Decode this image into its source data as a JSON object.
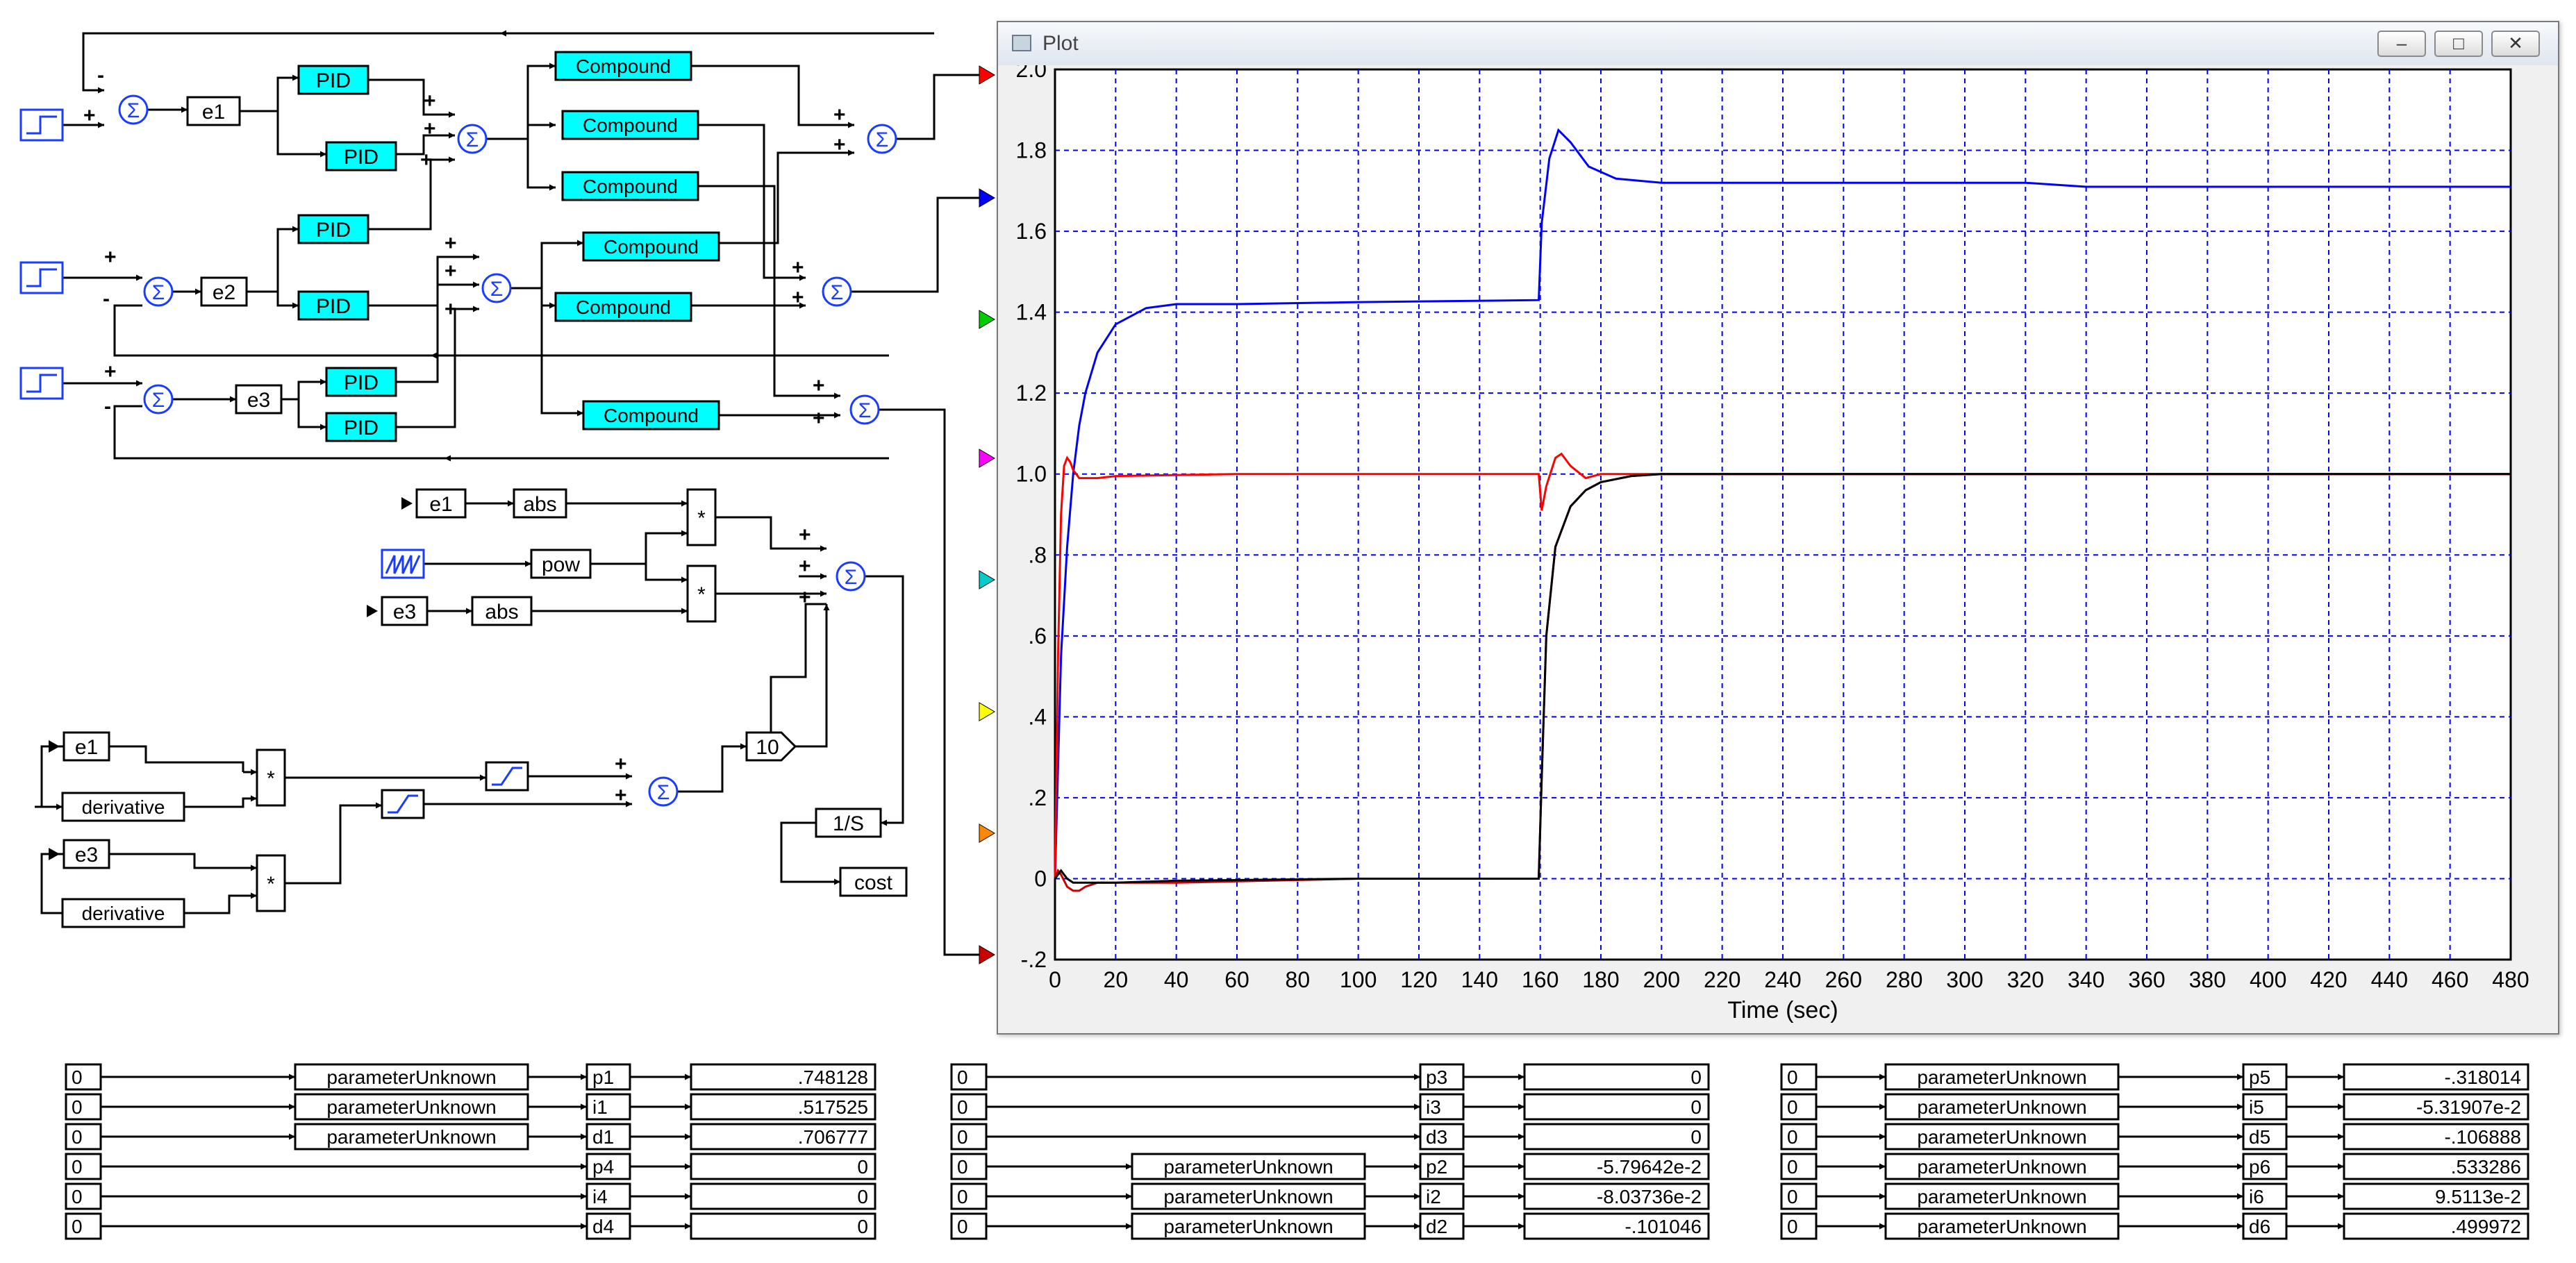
{
  "diagram": {
    "error_blocks": [
      "e1",
      "e2",
      "e3"
    ],
    "pid_label": "PID",
    "compound_label": "Compound",
    "sum_symbol": "Σ",
    "plus": "+",
    "minus": "-",
    "product_symbol": "*",
    "abs_label": "abs",
    "pow_label": "pow",
    "derivative_label": "derivative",
    "gain_label": "10",
    "integrator_label": "1/S",
    "cost_label": "cost"
  },
  "plot_window": {
    "title": "Plot",
    "minimize_icon": "minimize-icon",
    "restore_icon": "restore-icon",
    "close_icon": "close-icon"
  },
  "chart_data": {
    "type": "line",
    "xlabel": "Time (sec)",
    "ylabel": "",
    "xlim": [
      0,
      480
    ],
    "ylim": [
      -0.2,
      2.0
    ],
    "grid": true,
    "x_ticks": [
      "0",
      "20",
      "40",
      "60",
      "80",
      "100",
      "120",
      "140",
      "160",
      "180",
      "200",
      "220",
      "240",
      "260",
      "280",
      "300",
      "320",
      "340",
      "360",
      "380",
      "400",
      "420",
      "440",
      "460",
      "480"
    ],
    "y_ticks": [
      "2.0",
      "1.8",
      "1.6",
      "1.4",
      "1.2",
      "1.0",
      ".8",
      ".6",
      ".4",
      ".2",
      "0",
      "-.2"
    ],
    "series": [
      {
        "color": "#0000ff",
        "x": [
          0,
          2,
          4,
          6,
          8,
          10,
          14,
          20,
          30,
          40,
          60,
          100,
          159.5,
          160.5,
          163,
          166,
          170,
          176,
          185,
          200,
          260,
          320,
          340,
          400,
          480
        ],
        "y": [
          0,
          0.55,
          0.82,
          1.0,
          1.12,
          1.2,
          1.3,
          1.37,
          1.41,
          1.42,
          1.42,
          1.425,
          1.43,
          1.62,
          1.78,
          1.85,
          1.82,
          1.76,
          1.73,
          1.72,
          1.72,
          1.72,
          1.71,
          1.71,
          1.71
        ]
      },
      {
        "color": "#ff0000",
        "x": [
          0,
          1,
          2,
          3,
          4,
          5,
          6,
          8,
          10,
          14,
          20,
          60,
          159.5,
          160.5,
          162,
          165,
          167,
          170,
          175,
          180,
          200,
          480
        ],
        "y": [
          0,
          0.55,
          0.9,
          1.02,
          1.04,
          1.03,
          1.01,
          0.99,
          0.99,
          0.99,
          0.995,
          1.0,
          1.0,
          0.91,
          0.97,
          1.04,
          1.05,
          1.02,
          0.99,
          1.0,
          1.0,
          1.0
        ]
      },
      {
        "color": "#cc0000",
        "x": [
          0,
          1,
          2,
          4,
          6,
          8,
          10,
          14,
          20,
          40,
          100,
          159.5,
          160.5,
          162,
          165,
          170,
          175,
          180,
          190,
          200,
          480
        ],
        "y": [
          0,
          0.02,
          0.01,
          -0.02,
          -0.03,
          -0.03,
          -0.02,
          -0.01,
          -0.01,
          -0.01,
          0,
          0,
          0.25,
          0.6,
          0.82,
          0.92,
          0.96,
          0.98,
          0.995,
          1.0,
          1.0
        ]
      },
      {
        "color": "#000000",
        "x": [
          0,
          2,
          4,
          6,
          10,
          14,
          20,
          40,
          100,
          159.5,
          160.5,
          162,
          165,
          170,
          175,
          180,
          190,
          200,
          480
        ],
        "y": [
          0,
          0.02,
          0.0,
          -0.01,
          -0.01,
          -0.01,
          -0.01,
          -0.005,
          0,
          0,
          0.25,
          0.6,
          0.82,
          0.92,
          0.96,
          0.98,
          0.995,
          1.0,
          1.0
        ]
      }
    ]
  },
  "parameters": {
    "param_label": "parameterUnknown",
    "groups": [
      {
        "rows": [
          {
            "input": "0",
            "has_param": true,
            "name": "p1",
            "value": ".748128"
          },
          {
            "input": "0",
            "has_param": true,
            "name": "i1",
            "value": ".517525"
          },
          {
            "input": "0",
            "has_param": true,
            "name": "d1",
            "value": ".706777"
          },
          {
            "input": "0",
            "has_param": false,
            "name": "p4",
            "value": "0"
          },
          {
            "input": "0",
            "has_param": false,
            "name": "i4",
            "value": "0"
          },
          {
            "input": "0",
            "has_param": false,
            "name": "d4",
            "value": "0"
          }
        ]
      },
      {
        "rows": [
          {
            "input": "0",
            "has_param": false,
            "name": "p3",
            "value": "0"
          },
          {
            "input": "0",
            "has_param": false,
            "name": "i3",
            "value": "0"
          },
          {
            "input": "0",
            "has_param": false,
            "name": "d3",
            "value": "0"
          },
          {
            "input": "0",
            "has_param": true,
            "name": "p2",
            "value": "-5.79642e-2"
          },
          {
            "input": "0",
            "has_param": true,
            "name": "i2",
            "value": "-8.03736e-2"
          },
          {
            "input": "0",
            "has_param": true,
            "name": "d2",
            "value": "-.101046"
          }
        ]
      },
      {
        "rows": [
          {
            "input": "0",
            "has_param": true,
            "name": "p5",
            "value": "-.318014"
          },
          {
            "input": "0",
            "has_param": true,
            "name": "i5",
            "value": "-5.31907e-2"
          },
          {
            "input": "0",
            "has_param": true,
            "name": "d5",
            "value": "-.106888"
          },
          {
            "input": "0",
            "has_param": true,
            "name": "p6",
            "value": ".533286"
          },
          {
            "input": "0",
            "has_param": true,
            "name": "i6",
            "value": "9.5113e-2"
          },
          {
            "input": "0",
            "has_param": true,
            "name": "d6",
            "value": ".499972"
          }
        ]
      }
    ]
  },
  "colors": {
    "pid_fill": "#00ffff",
    "sum_stroke": "#1a3cff",
    "wire": "#000000",
    "plot_grid": "#0000ff",
    "connector_colors": [
      "#ff0000",
      "#0000ff",
      "#00cc00",
      "#ff00ff",
      "#00cccc",
      "#ffff00",
      "#ff8800",
      "#cc0000"
    ]
  }
}
